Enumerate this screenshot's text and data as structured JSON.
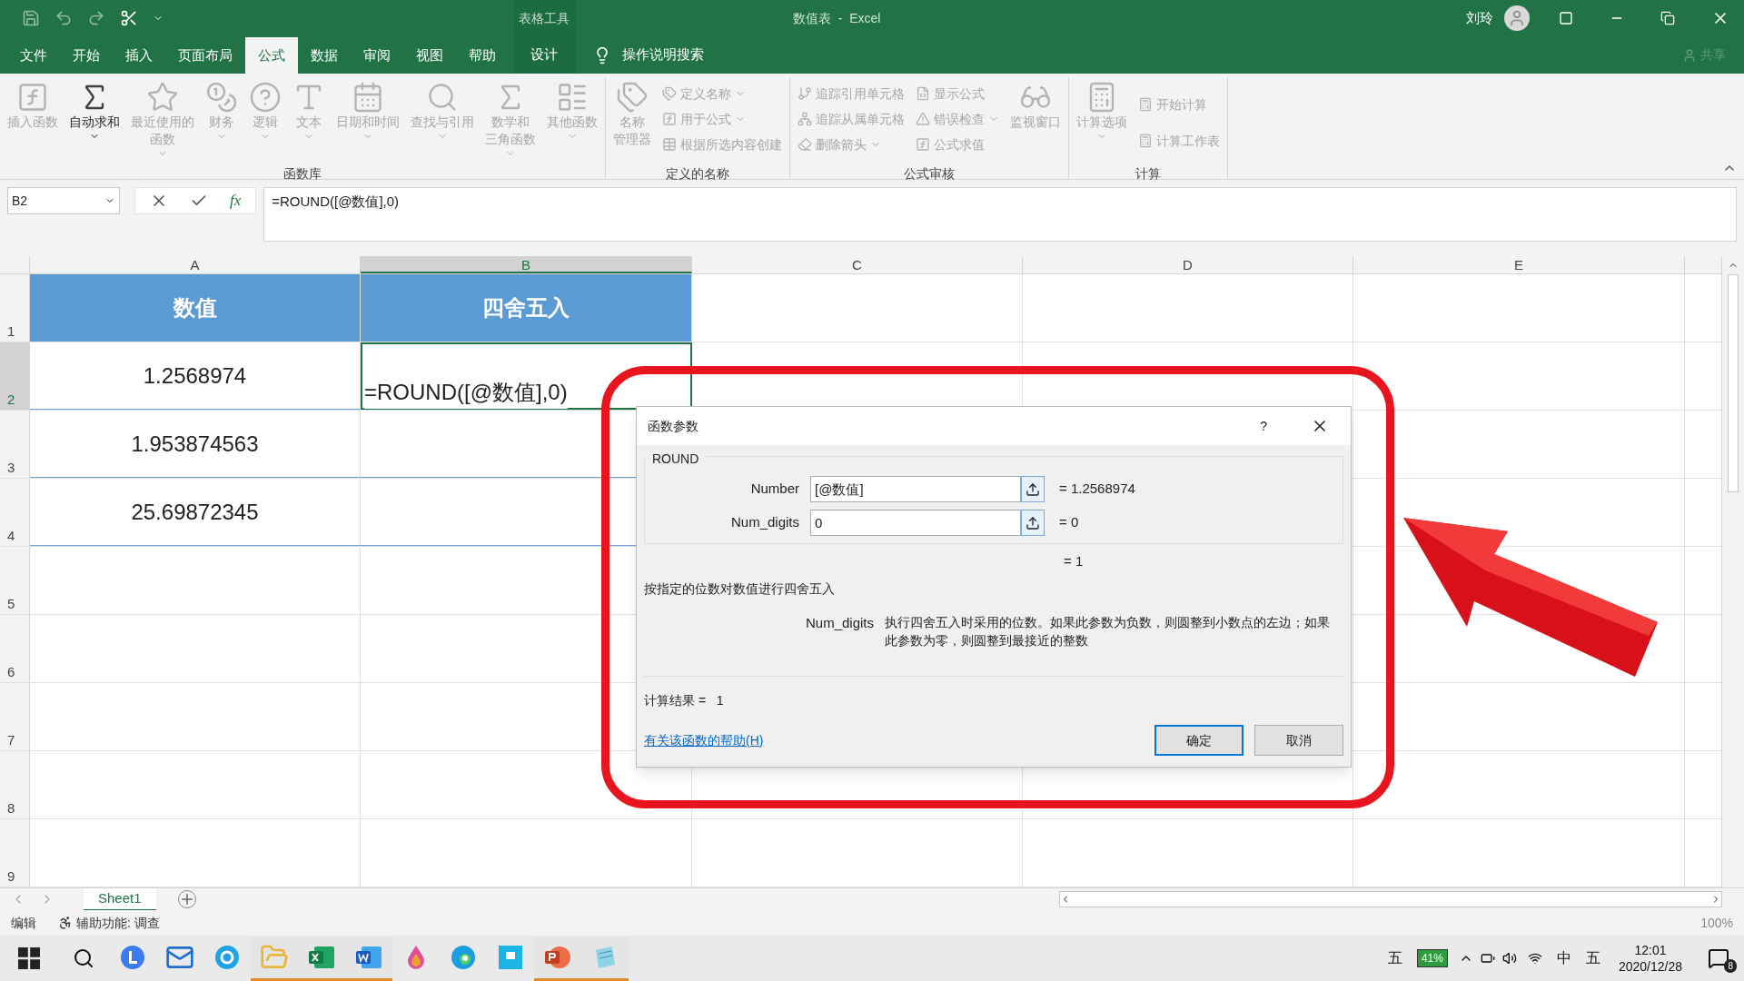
{
  "window": {
    "title": "数值表  -  Excel",
    "contextual_group": "表格工具",
    "user": "刘玲"
  },
  "tabs": [
    {
      "label": "文件",
      "selected": false
    },
    {
      "label": "开始",
      "selected": false
    },
    {
      "label": "插入",
      "selected": false
    },
    {
      "label": "页面布局",
      "selected": false
    },
    {
      "label": "公式",
      "selected": true
    },
    {
      "label": "数据",
      "selected": false
    },
    {
      "label": "审阅",
      "selected": false
    },
    {
      "label": "视图",
      "selected": false
    },
    {
      "label": "帮助",
      "selected": false
    }
  ],
  "contextual_tab": {
    "label": "设计",
    "selected": false
  },
  "tell_me": "操作说明搜索",
  "share": "共享",
  "ribbon": [
    {
      "label": "函数库",
      "items": [
        {
          "kind": "large",
          "lines": [
            "插入函数"
          ],
          "disabled": true,
          "dropdown": false
        },
        {
          "kind": "large",
          "lines": [
            "自动求和"
          ],
          "disabled": false,
          "dropdown": true
        },
        {
          "kind": "large",
          "lines": [
            "最近使用的",
            "函数"
          ],
          "disabled": true,
          "dropdown": true
        },
        {
          "kind": "large",
          "lines": [
            "财务"
          ],
          "disabled": true,
          "dropdown": true
        },
        {
          "kind": "large",
          "lines": [
            "逻辑"
          ],
          "disabled": true,
          "dropdown": true
        },
        {
          "kind": "large",
          "lines": [
            "文本"
          ],
          "disabled": true,
          "dropdown": true
        },
        {
          "kind": "large",
          "lines": [
            "日期和时间"
          ],
          "disabled": true,
          "dropdown": true
        },
        {
          "kind": "large",
          "lines": [
            "查找与引用"
          ],
          "disabled": true,
          "dropdown": true
        },
        {
          "kind": "large",
          "lines": [
            "数学和",
            "三角函数"
          ],
          "disabled": true,
          "dropdown": true
        },
        {
          "kind": "large",
          "lines": [
            "其他函数"
          ],
          "disabled": true,
          "dropdown": true
        }
      ]
    },
    {
      "label": "定义的名称",
      "items": [
        {
          "kind": "large",
          "lines": [
            "名称",
            "管理器"
          ],
          "disabled": true,
          "dropdown": false
        },
        {
          "kind": "small",
          "lines": [
            "定义名称"
          ],
          "disabled": true,
          "dropdown": true
        },
        {
          "kind": "small",
          "lines": [
            "用于公式"
          ],
          "disabled": true,
          "dropdown": true
        },
        {
          "kind": "small",
          "lines": [
            "根据所选内容创建"
          ],
          "disabled": true,
          "dropdown": false
        }
      ]
    },
    {
      "label": "公式审核",
      "items": [
        {
          "kind": "small",
          "lines": [
            "追踪引用单元格"
          ],
          "disabled": true,
          "dropdown": false
        },
        {
          "kind": "small",
          "lines": [
            "追踪从属单元格"
          ],
          "disabled": true,
          "dropdown": false
        },
        {
          "kind": "small",
          "lines": [
            "删除箭头"
          ],
          "disabled": true,
          "dropdown": true
        },
        {
          "kind": "small",
          "lines": [
            "显示公式"
          ],
          "disabled": true,
          "dropdown": false
        },
        {
          "kind": "small",
          "lines": [
            "错误检查"
          ],
          "disabled": true,
          "dropdown": true
        },
        {
          "kind": "small",
          "lines": [
            "公式求值"
          ],
          "disabled": true,
          "dropdown": false
        },
        {
          "kind": "large",
          "lines": [
            "监视窗口"
          ],
          "disabled": true,
          "dropdown": false
        }
      ]
    },
    {
      "label": "计算",
      "items": [
        {
          "kind": "large",
          "lines": [
            "计算选项"
          ],
          "disabled": true,
          "dropdown": true
        },
        {
          "kind": "small",
          "lines": [
            "开始计算"
          ],
          "disabled": true,
          "dropdown": false
        },
        {
          "kind": "small",
          "lines": [
            "计算工作表"
          ],
          "disabled": true,
          "dropdown": false
        }
      ]
    }
  ],
  "formula_bar": {
    "name_box": "B2",
    "fx_label": "fx",
    "formula": "=ROUND([@数值],0)"
  },
  "sheet": {
    "columns": [
      {
        "label": "A",
        "selected": false
      },
      {
        "label": "B",
        "selected": true
      },
      {
        "label": "C",
        "selected": false
      },
      {
        "label": "D",
        "selected": false
      },
      {
        "label": "E",
        "selected": false
      }
    ],
    "rows": [
      {
        "number": "1",
        "selected": false,
        "cells": [
          "数值",
          "四舍五入",
          "",
          "",
          ""
        ]
      },
      {
        "number": "2",
        "selected": true,
        "cells": [
          "1.2568974",
          "=ROUND([@数值],0)",
          "",
          "",
          ""
        ]
      },
      {
        "number": "3",
        "selected": false,
        "cells": [
          "1.953874563",
          "",
          "",
          "",
          ""
        ]
      },
      {
        "number": "4",
        "selected": false,
        "cells": [
          "25.69872345",
          "",
          "",
          "",
          ""
        ]
      },
      {
        "number": "5",
        "selected": false,
        "cells": [
          "",
          "",
          "",
          "",
          ""
        ]
      },
      {
        "number": "6",
        "selected": false,
        "cells": [
          "",
          "",
          "",
          "",
          ""
        ]
      },
      {
        "number": "7",
        "selected": false,
        "cells": [
          "",
          "",
          "",
          "",
          ""
        ]
      },
      {
        "number": "8",
        "selected": false,
        "cells": [
          "",
          "",
          "",
          "",
          ""
        ]
      },
      {
        "number": "9",
        "selected": false,
        "cells": [
          "",
          "",
          "",
          "",
          ""
        ]
      }
    ]
  },
  "dialog": {
    "title": "函数参数",
    "help_glyph": "?",
    "function": "ROUND",
    "args": [
      {
        "label": "Number",
        "value": "[@数值]",
        "result": "= 1.2568974"
      },
      {
        "label": "Num_digits",
        "value": "0",
        "result": "= 0"
      }
    ],
    "result": "= 1",
    "description": "按指定的位数对数值进行四舍五入",
    "arg_name": "Num_digits",
    "arg_help": "执行四舍五入时采用的位数。如果此参数为负数，则圆整到小数点的左边；如果此参数为零，则圆整到最接近的整数",
    "calc_result": "计算结果 =   1",
    "help_link": "有关该函数的帮助(H)",
    "buttons": [
      {
        "label": "确定",
        "default": true
      },
      {
        "label": "取消",
        "default": false
      }
    ]
  },
  "sheet_tabs": [
    {
      "label": "Sheet1",
      "selected": true
    }
  ],
  "status_bar": {
    "mode": "编辑",
    "accessibility": "辅助功能: 调查",
    "zoom": "100%"
  },
  "taskbar": {
    "apps": [
      {
        "kind": "browser",
        "running": false
      },
      {
        "kind": "mail",
        "running": false
      },
      {
        "kind": "ie",
        "running": false
      },
      {
        "kind": "folder",
        "running": true
      },
      {
        "kind": "excel",
        "running": true
      },
      {
        "kind": "word",
        "running": true
      },
      {
        "kind": "paint",
        "running": false
      },
      {
        "kind": "edge",
        "running": false
      },
      {
        "kind": "tool",
        "running": false
      },
      {
        "kind": "powerpoint",
        "running": true
      },
      {
        "kind": "note",
        "running": true
      }
    ],
    "ime_left": "五",
    "battery": "41%",
    "ime_lang": "中",
    "ime_right": "五",
    "time": "12:01",
    "date": "2020/12/28",
    "notifications": "8"
  }
}
